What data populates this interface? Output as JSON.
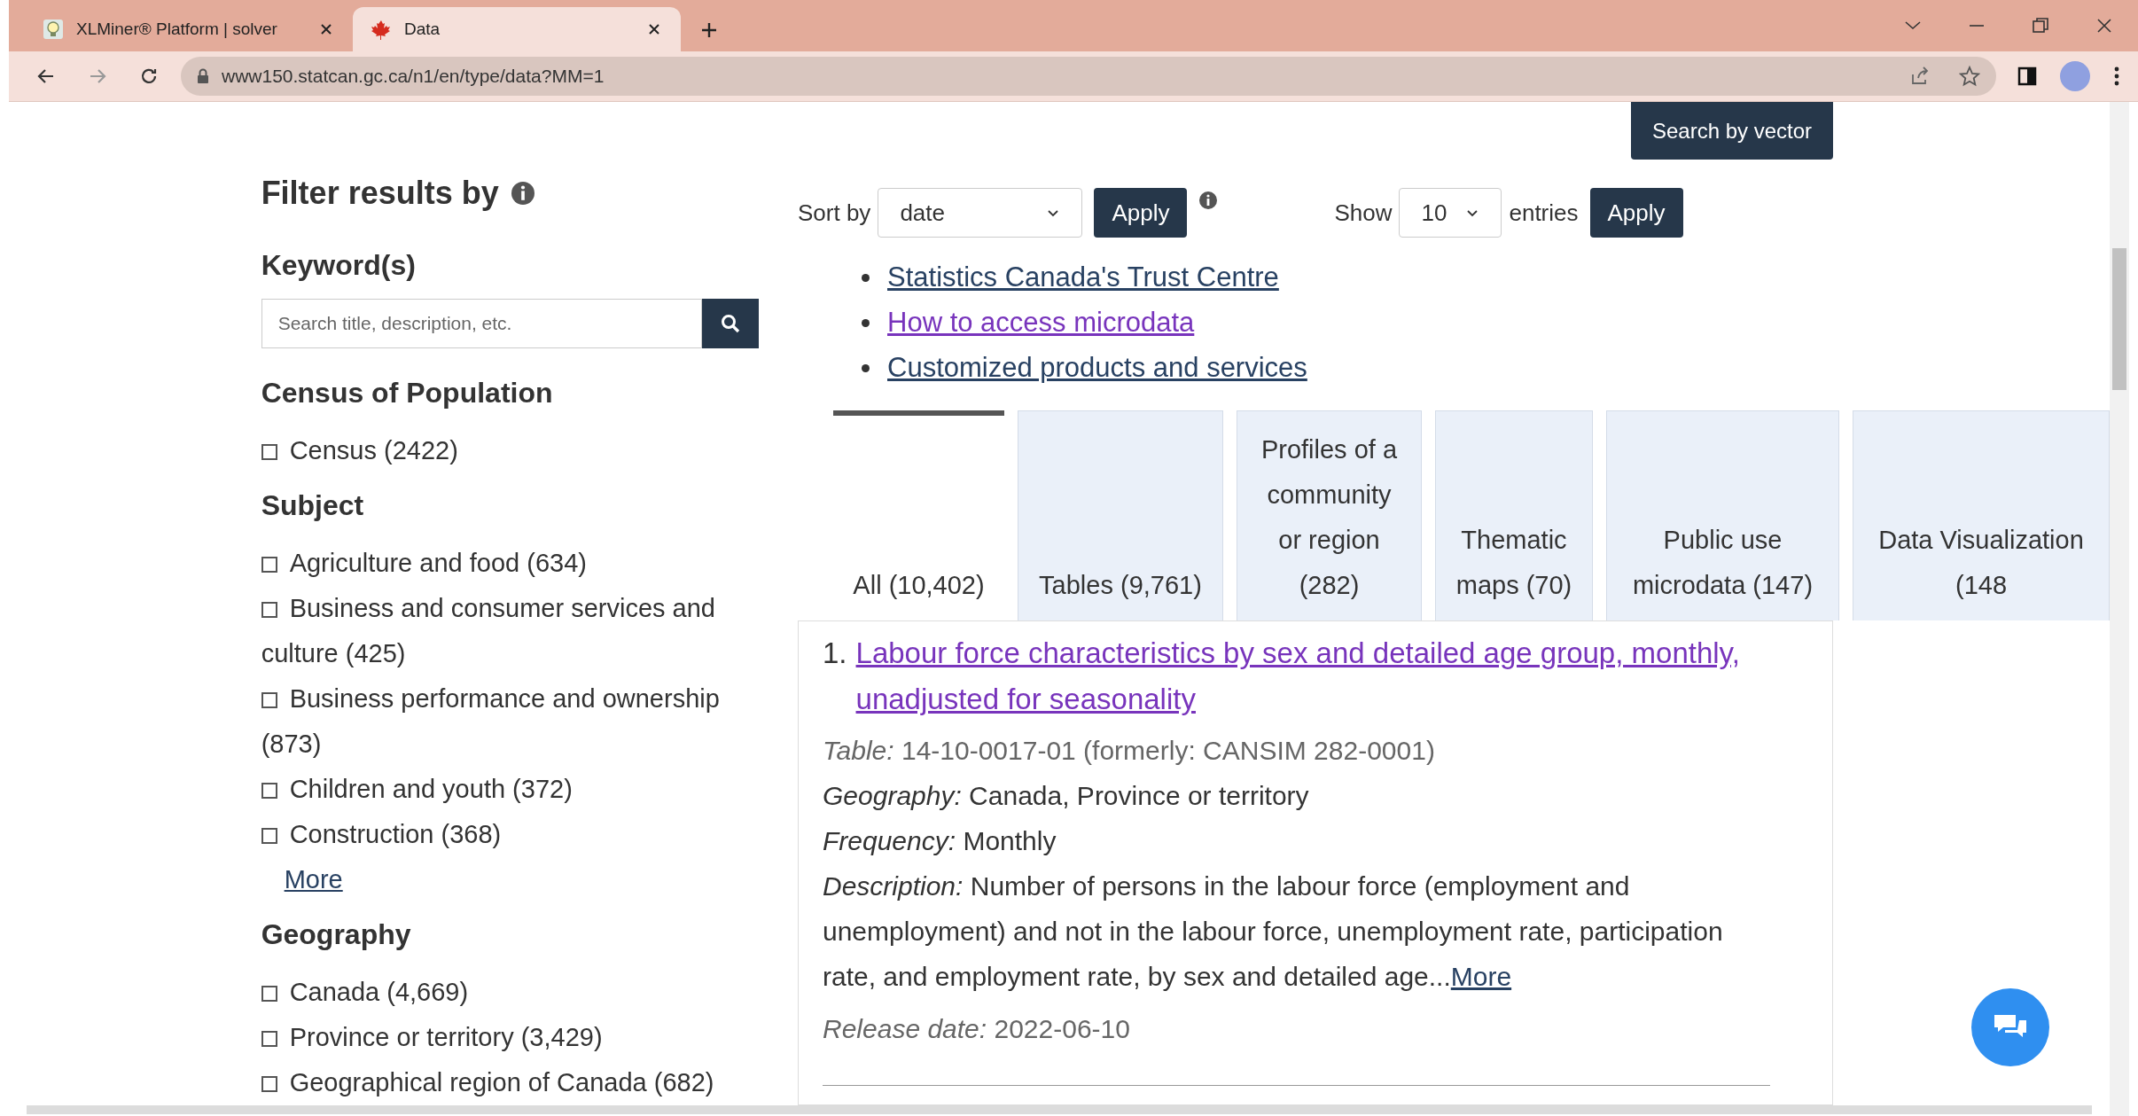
{
  "browser": {
    "tabs": [
      {
        "title": "XLMiner® Platform | solver",
        "selected": false
      },
      {
        "title": "Data",
        "selected": true
      }
    ],
    "address": "www150.statcan.gc.ca/n1/en/type/data?MM=1"
  },
  "search_by_vector": "Search by vector",
  "filter": {
    "title": "Filter results by",
    "keyword": {
      "heading": "Keyword(s)",
      "placeholder": "Search title, description, etc."
    },
    "groups": [
      {
        "heading": "Census of Population",
        "items": [
          {
            "label": "Census (2422)",
            "checked": false
          }
        ]
      },
      {
        "heading": "Subject",
        "items": [
          {
            "label": "Agriculture and food (634)",
            "checked": false
          },
          {
            "label": "Business and consumer services and culture (425)",
            "checked": false
          },
          {
            "label": "Business performance and ownership (873)",
            "checked": false
          },
          {
            "label": "Children and youth (372)",
            "checked": false
          },
          {
            "label": "Construction (368)",
            "checked": false
          }
        ],
        "more": "More"
      },
      {
        "heading": "Geography",
        "items": [
          {
            "label": "Canada (4,669)",
            "checked": false
          },
          {
            "label": "Province or territory (3,429)",
            "checked": false
          },
          {
            "label": "Geographical region of Canada (682)",
            "checked": false
          }
        ]
      }
    ]
  },
  "sort": {
    "label": "Sort by",
    "value": "date",
    "button": "Apply"
  },
  "show": {
    "label": "Show",
    "value": "10",
    "suffix": "entries",
    "button": "Apply"
  },
  "links": [
    {
      "text": "Statistics Canada's Trust Centre",
      "visited": false
    },
    {
      "text": "How to access microdata",
      "visited": true
    },
    {
      "text": "Customized products and services",
      "visited": false
    }
  ],
  "result_tabs": [
    {
      "label": "All (10,402)",
      "selected": true
    },
    {
      "label": "Tables (9,761)",
      "selected": false
    },
    {
      "label": "Profiles of a community or region (282)",
      "selected": false
    },
    {
      "label": "Thematic maps (70)",
      "selected": false
    },
    {
      "label": "Public use microdata (147)",
      "selected": false
    },
    {
      "label": "Data Visualization (148",
      "selected": false
    }
  ],
  "result": {
    "number": "1.",
    "title": "Labour force characteristics by sex and detailed age group, monthly, unadjusted for seasonality",
    "fields": [
      {
        "label": "Table:",
        "value": "14-10-0017-01 (formerly: CANSIM 282-0001)",
        "muted": true
      },
      {
        "label": "Geography:",
        "value": "Canada, Province or territory",
        "muted": false
      },
      {
        "label": "Frequency:",
        "value": "Monthly",
        "muted": false
      },
      {
        "label": "Description:",
        "value": "Number of persons in the labour force (employment and unemployment) and not in the labour force, unemployment rate, participation rate, and employment rate, by sex and detailed age...",
        "muted": false,
        "more": "More"
      },
      {
        "label": "Release date:",
        "value": "2022-06-10",
        "muted": true
      }
    ]
  }
}
